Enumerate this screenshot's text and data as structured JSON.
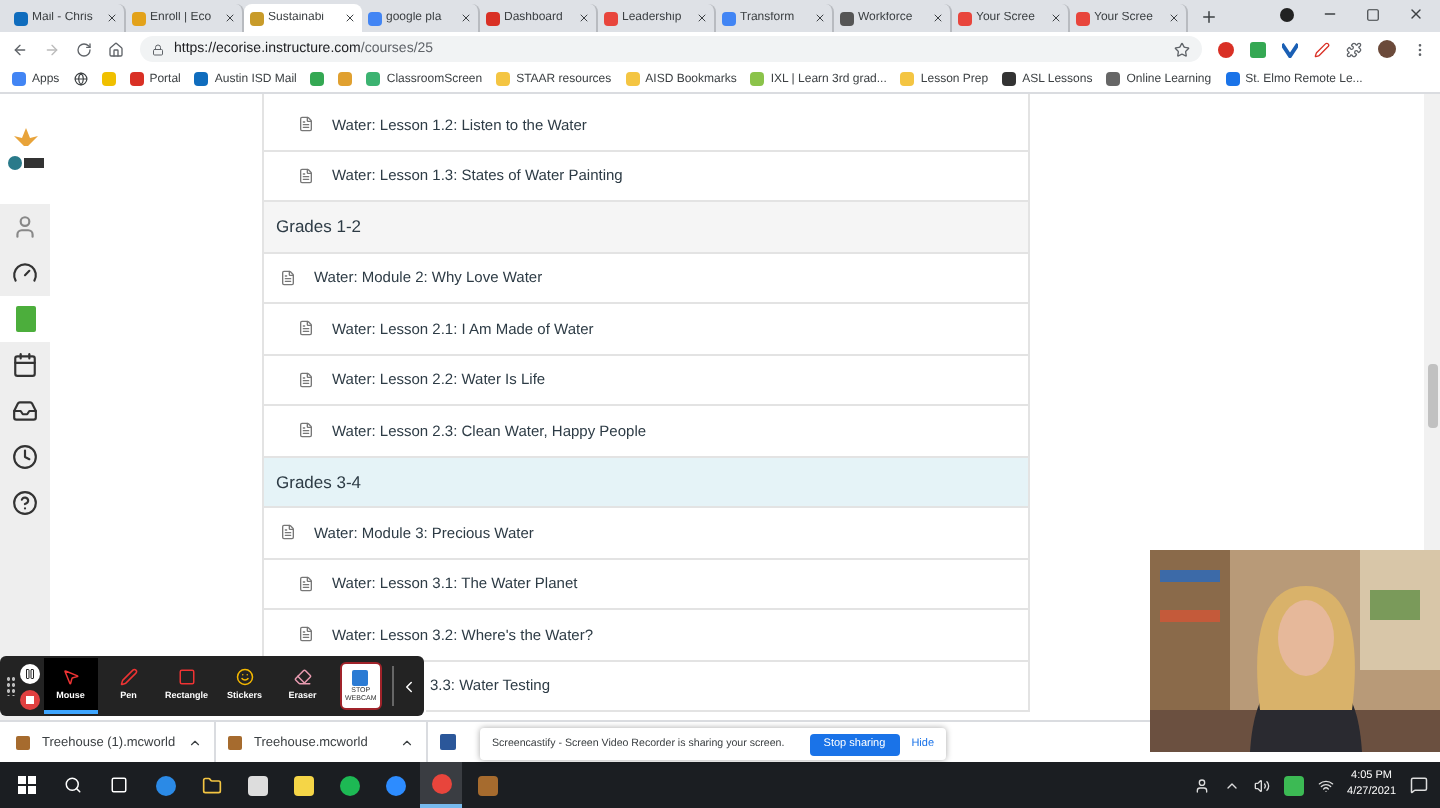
{
  "browser": {
    "tabs": [
      {
        "label": "Mail - Chris",
        "selected": false
      },
      {
        "label": "Enroll | Eco",
        "selected": false
      },
      {
        "label": "Sustainabi",
        "selected": true
      },
      {
        "label": "google pla",
        "selected": false
      },
      {
        "label": "Dashboard",
        "selected": false
      },
      {
        "label": "Leadership",
        "selected": false
      },
      {
        "label": "Transform",
        "selected": false
      },
      {
        "label": "Workforce",
        "selected": false
      },
      {
        "label": "Your Scree",
        "selected": false
      },
      {
        "label": "Your Scree",
        "selected": false
      }
    ],
    "url_host": "https://ecorise.instructure.com",
    "url_path": "/courses/25",
    "bookmarks": [
      "Apps",
      "Portal",
      "Austin ISD Mail",
      "ClassroomScreen",
      "STAAR resources",
      "AISD Bookmarks",
      "IXL | Learn 3rd grad...",
      "Lesson Prep",
      "ASL Lessons",
      "Online Learning",
      "St. Elmo Remote Le..."
    ]
  },
  "modules": [
    {
      "kind": "lesson",
      "title": "Water: Lesson 1.2: Listen to the Water",
      "highlighted": false
    },
    {
      "kind": "lesson",
      "title": "Water: Lesson 1.3: States of Water Painting",
      "highlighted": false
    },
    {
      "kind": "group",
      "title": "Grades 1-2",
      "highlighted": false
    },
    {
      "kind": "module",
      "title": "Water: Module 2: Why Love Water",
      "highlighted": false
    },
    {
      "kind": "lesson",
      "title": "Water: Lesson 2.1: I Am Made of Water",
      "highlighted": false
    },
    {
      "kind": "lesson",
      "title": "Water: Lesson 2.2: Water Is Life",
      "highlighted": false
    },
    {
      "kind": "lesson",
      "title": "Water: Lesson 2.3: Clean Water, Happy People",
      "highlighted": false
    },
    {
      "kind": "group",
      "title": "Grades 3-4",
      "highlighted": true
    },
    {
      "kind": "module",
      "title": "Water: Module 3: Precious Water",
      "highlighted": false
    },
    {
      "kind": "lesson",
      "title": "Water: Lesson 3.1: The Water Planet",
      "highlighted": false
    },
    {
      "kind": "lesson",
      "title": "Water: Lesson 3.2: Where's the Water?",
      "highlighted": false
    },
    {
      "kind": "covered",
      "title": "3.3: Water Testing",
      "highlighted": false
    }
  ],
  "recorder": {
    "tools": [
      {
        "kind": "mouse",
        "label": "Mouse",
        "selected": true
      },
      {
        "kind": "pen",
        "label": "Pen",
        "selected": false
      },
      {
        "kind": "rectangle",
        "label": "Rectangle",
        "selected": false
      },
      {
        "kind": "stickers",
        "label": "Stickers",
        "selected": false
      },
      {
        "kind": "eraser",
        "label": "Eraser",
        "selected": false
      }
    ],
    "webcam_button": "STOP WEBCAM"
  },
  "downloads": [
    "Treehouse (1).mcworld",
    "Treehouse.mcworld"
  ],
  "notice": {
    "text": "Screencastify - Screen Video Recorder is sharing your screen.",
    "button": "Stop sharing",
    "link": "Hide"
  },
  "taskbar": {
    "time": "4:05 PM",
    "date": "4/27/2021"
  }
}
